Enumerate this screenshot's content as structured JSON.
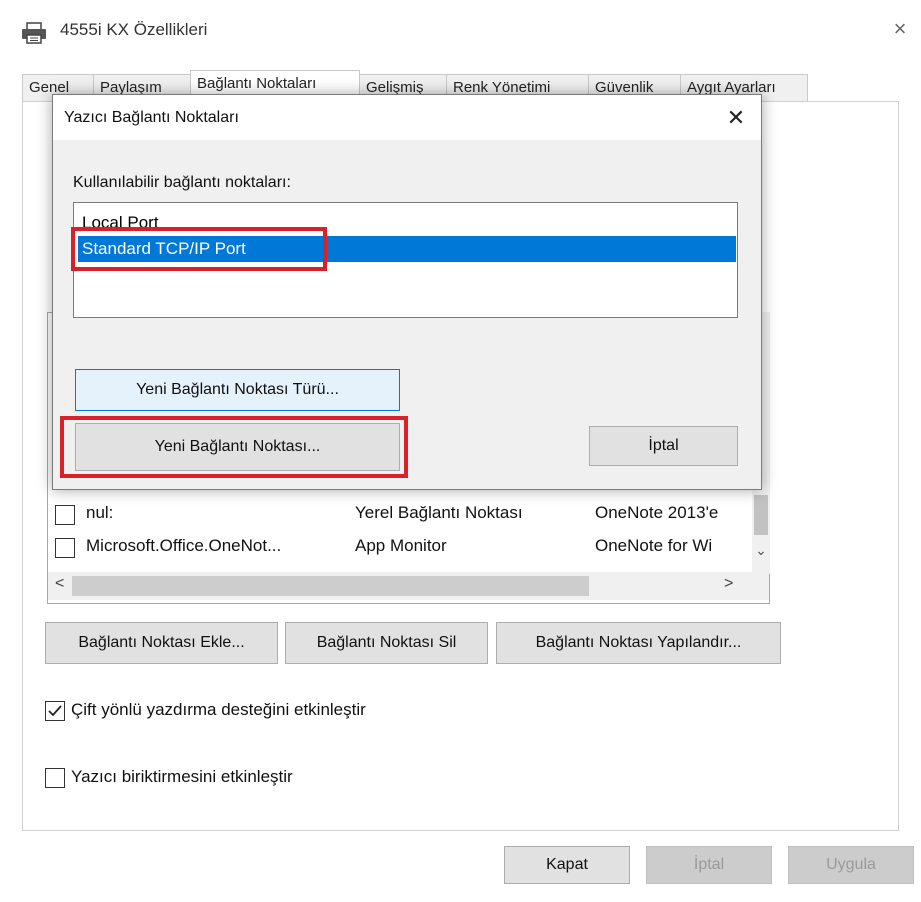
{
  "window": {
    "title": "4555i KX Özellikleri",
    "close_label": "×"
  },
  "tabs": [
    {
      "label": "Genel"
    },
    {
      "label": "Paylaşım"
    },
    {
      "label": "Bağlantı Noktaları"
    },
    {
      "label": "Gelişmiş"
    },
    {
      "label": "Renk Yönetimi"
    },
    {
      "label": "Güvenlik"
    },
    {
      "label": "Aygıt Ayarları"
    }
  ],
  "port_table": {
    "rows": [
      {
        "port": "nul:",
        "description": "Yerel Bağlantı Noktası",
        "printer": "OneNote 2013'e",
        "checked": false
      },
      {
        "port": "Microsoft.Office.OneNot...",
        "description": "App Monitor",
        "printer": "OneNote for Wi",
        "checked": false
      }
    ],
    "hscroll_left": "<",
    "hscroll_right": ">",
    "vscroll_down": "⌄"
  },
  "port_buttons": {
    "add": "Bağlantı Noktası Ekle...",
    "delete": "Bağlantı Noktası Sil",
    "configure": "Bağlantı Noktası Yapılandır..."
  },
  "options": {
    "bidirectional": {
      "label": "Çift yönlü yazdırma desteğini etkinleştir",
      "checked": true
    },
    "pooling": {
      "label": "Yazıcı biriktirmesini etkinleştir",
      "checked": false
    }
  },
  "footer": {
    "close": "Kapat",
    "cancel": "İptal",
    "apply": "Uygula"
  },
  "dialog": {
    "title": "Yazıcı Bağlantı Noktaları",
    "close_label": "✕",
    "available_label": "Kullanılabilir bağlantı noktaları:",
    "ports": [
      {
        "label": "Local Port",
        "selected": false
      },
      {
        "label": "Standard TCP/IP Port",
        "selected": true
      }
    ],
    "new_port_type": "Yeni Bağlantı Noktası Türü...",
    "new_port": "Yeni Bağlantı Noktası...",
    "cancel": "İptal"
  },
  "colors": {
    "selection": "#0078d7",
    "highlight_box": "#d8212b",
    "accent_border": "#0078d7"
  }
}
